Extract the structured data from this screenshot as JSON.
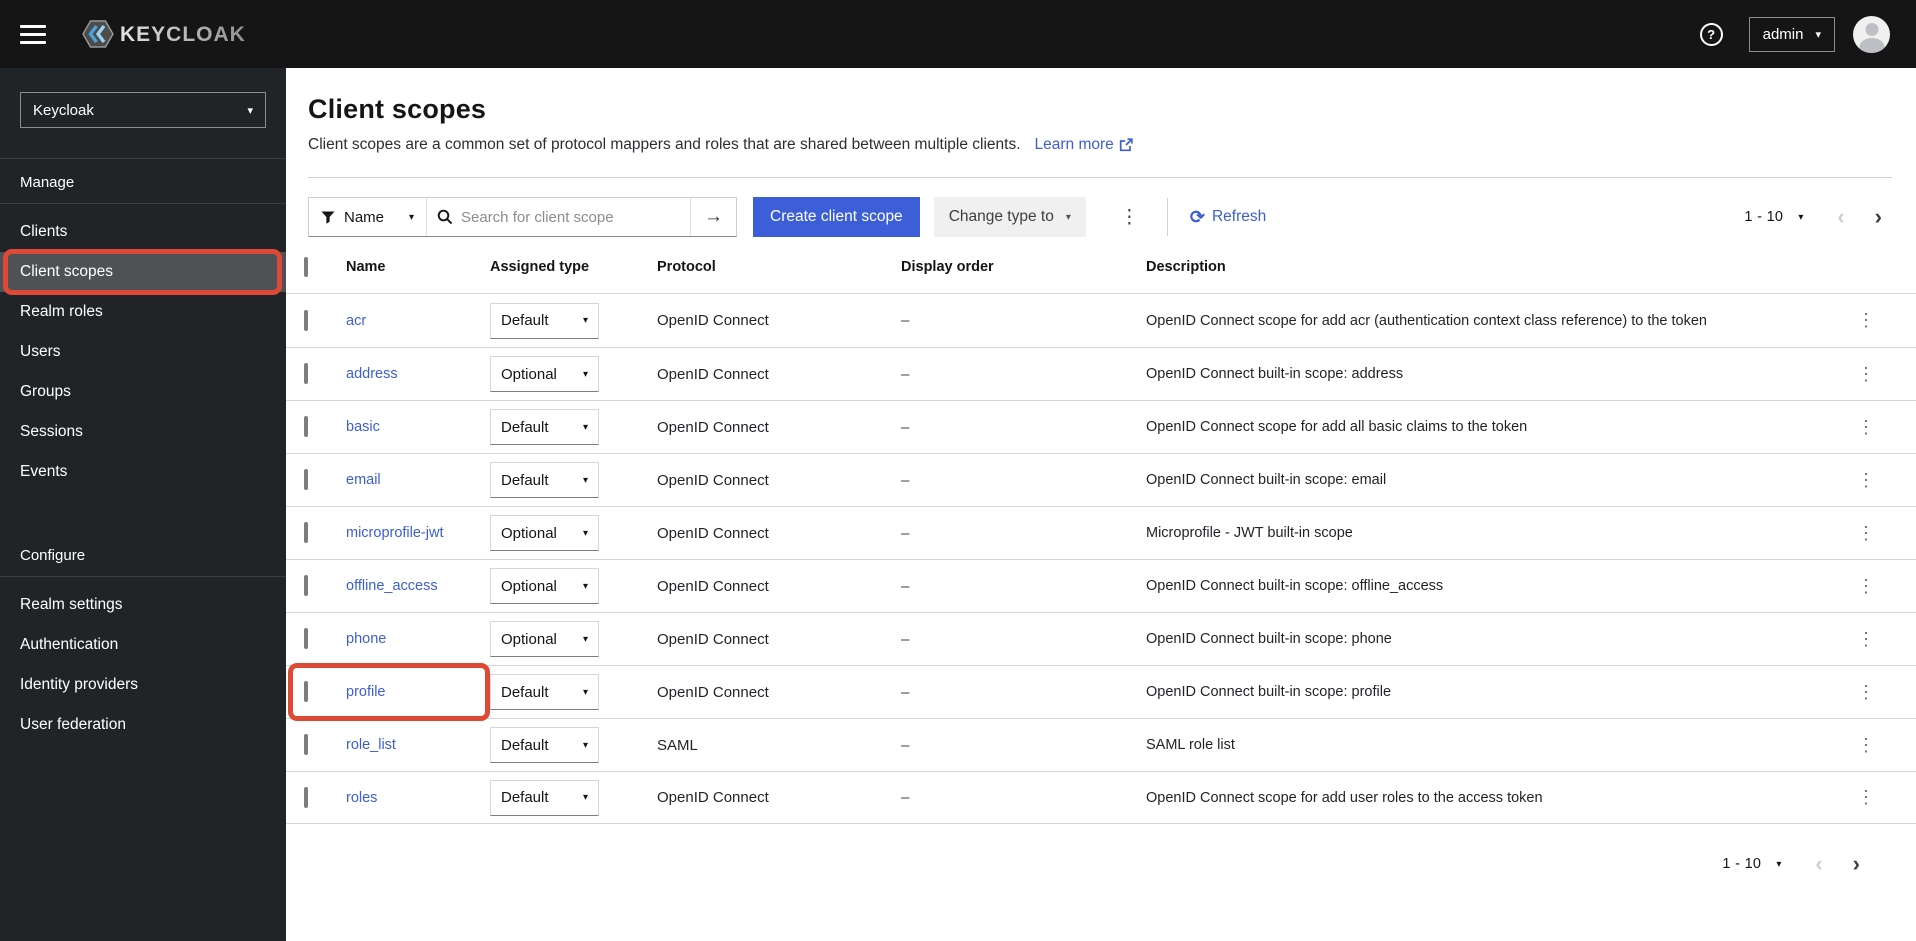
{
  "colors": {
    "masthead": "#151515",
    "sidebar": "#212427",
    "sidebar_selected": "#4f5255",
    "accent": "#3c5ed6",
    "annotation": "#dd4937",
    "border": "#d2d2d2",
    "row_border": "#d7d7d7",
    "text": "#151515",
    "muted": "#6a6e73"
  },
  "icons": {
    "caret_down": "▾",
    "kebab": "⋮",
    "arrow_right": "→",
    "refresh": "⟳",
    "chevron_left": "‹",
    "chevron_right": "›",
    "help": "?"
  },
  "masthead": {
    "brand": "KEYCLOAK",
    "user": "admin"
  },
  "sidebar": {
    "realm": "Keycloak",
    "selected_item": "Client scopes",
    "sections": [
      {
        "label": "Manage",
        "items": [
          "Clients",
          "Client scopes",
          "Realm roles",
          "Users",
          "Groups",
          "Sessions",
          "Events"
        ]
      },
      {
        "label": "Configure",
        "items": [
          "Realm settings",
          "Authentication",
          "Identity providers",
          "User federation"
        ]
      }
    ]
  },
  "page": {
    "title": "Client scopes",
    "description": "Client scopes are a common set of protocol mappers and roles that are shared between multiple clients.",
    "learn_more": "Learn more"
  },
  "toolbar": {
    "filter_label": "Name",
    "search_placeholder": "Search for client scope",
    "create_button": "Create client scope",
    "change_type_button": "Change type to",
    "refresh_label": "Refresh",
    "pagination_range": "1 - 10"
  },
  "table": {
    "columns": [
      "Name",
      "Assigned type",
      "Protocol",
      "Display order",
      "Description"
    ],
    "rows": [
      {
        "name": "acr",
        "assigned_type": "Default",
        "protocol": "OpenID Connect",
        "display_order": "–",
        "description": "OpenID Connect scope for add acr (authentication context class reference) to the token"
      },
      {
        "name": "address",
        "assigned_type": "Optional",
        "protocol": "OpenID Connect",
        "display_order": "–",
        "description": "OpenID Connect built-in scope: address"
      },
      {
        "name": "basic",
        "assigned_type": "Default",
        "protocol": "OpenID Connect",
        "display_order": "–",
        "description": "OpenID Connect scope for add all basic claims to the token"
      },
      {
        "name": "email",
        "assigned_type": "Default",
        "protocol": "OpenID Connect",
        "display_order": "–",
        "description": "OpenID Connect built-in scope: email"
      },
      {
        "name": "microprofile-jwt",
        "assigned_type": "Optional",
        "protocol": "OpenID Connect",
        "display_order": "–",
        "description": "Microprofile - JWT built-in scope"
      },
      {
        "name": "offline_access",
        "assigned_type": "Optional",
        "protocol": "OpenID Connect",
        "display_order": "–",
        "description": "OpenID Connect built-in scope: offline_access"
      },
      {
        "name": "phone",
        "assigned_type": "Optional",
        "protocol": "OpenID Connect",
        "display_order": "–",
        "description": "OpenID Connect built-in scope: phone"
      },
      {
        "name": "profile",
        "assigned_type": "Default",
        "protocol": "OpenID Connect",
        "display_order": "–",
        "description": "OpenID Connect built-in scope: profile",
        "highlighted": true
      },
      {
        "name": "role_list",
        "assigned_type": "Default",
        "protocol": "SAML",
        "display_order": "–",
        "description": "SAML role list"
      },
      {
        "name": "roles",
        "assigned_type": "Default",
        "protocol": "OpenID Connect",
        "display_order": "–",
        "description": "OpenID Connect scope for add user roles to the access token"
      }
    ]
  },
  "footer": {
    "pagination_range": "1 - 10"
  }
}
